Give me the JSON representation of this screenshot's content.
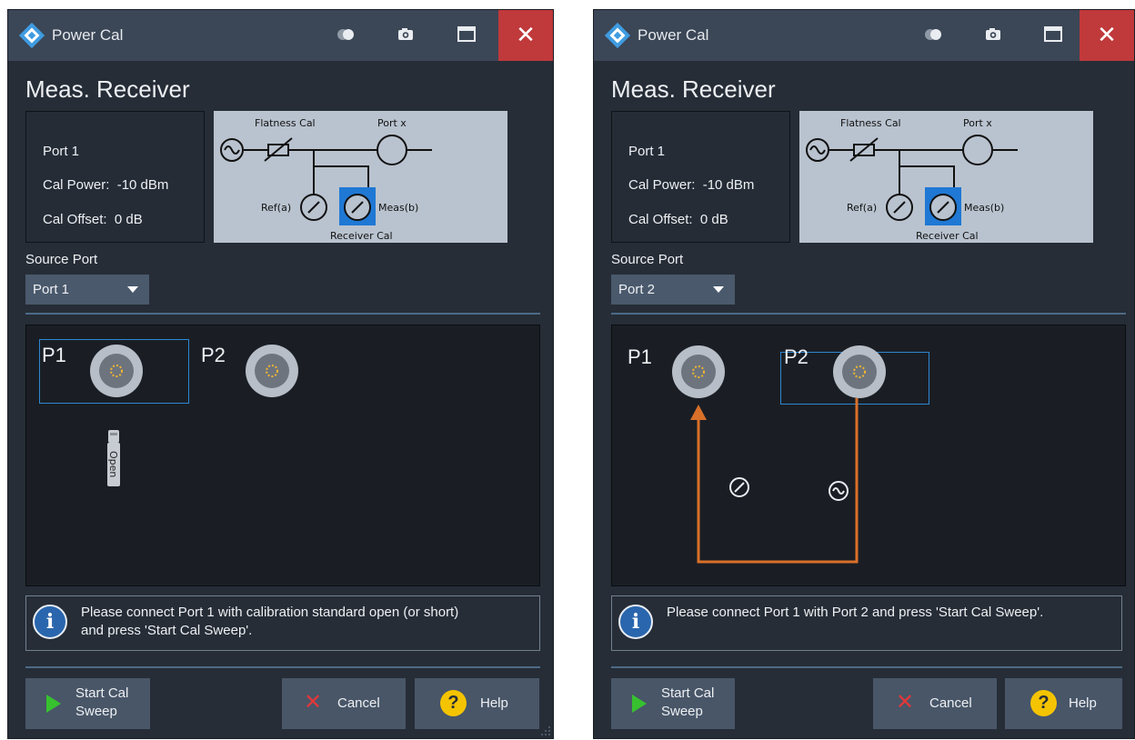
{
  "left": {
    "title": "Power Cal",
    "heading": "Meas. Receiver",
    "info": {
      "port": "Port 1",
      "cal_power": "Cal Power:  -10 dBm",
      "cal_offset": "Cal Offset:  0 dB"
    },
    "schematic": {
      "flatness": "Flatness Cal",
      "portx": "Port x",
      "ref": "Ref(a)",
      "meas": "Meas(b)",
      "receiver": "Receiver Cal"
    },
    "source_port_label": "Source Port",
    "source_port_value": "Port 1",
    "ports": {
      "p1": "P1",
      "p2": "P2"
    },
    "open_label": "Open",
    "message": "Please connect Port 1 with calibration standard open (or short)\nand press 'Start Cal Sweep'.",
    "buttons": {
      "start_line1": "Start Cal",
      "start_line2": "Sweep",
      "cancel": "Cancel",
      "help": "Help"
    }
  },
  "right": {
    "title": "Power Cal",
    "heading": "Meas. Receiver",
    "info": {
      "port": "Port 1",
      "cal_power": "Cal Power:  -10 dBm",
      "cal_offset": "Cal Offset:  0 dB"
    },
    "schematic": {
      "flatness": "Flatness Cal",
      "portx": "Port x",
      "ref": "Ref(a)",
      "meas": "Meas(b)",
      "receiver": "Receiver Cal"
    },
    "source_port_label": "Source Port",
    "source_port_value": "Port 2",
    "ports": {
      "p1": "P1",
      "p2": "P2"
    },
    "message": "Please connect Port 1 with Port 2 and press 'Start Cal Sweep'.",
    "buttons": {
      "start_line1": "Start Cal",
      "start_line2": "Sweep",
      "cancel": "Cancel",
      "help": "Help"
    }
  },
  "colors": {
    "dialog_bg": "#262d37",
    "titlebar": "#3b4656",
    "close": "#c0393b",
    "accent_blue": "#2d87d3",
    "arrow_orange": "#d9702a"
  }
}
